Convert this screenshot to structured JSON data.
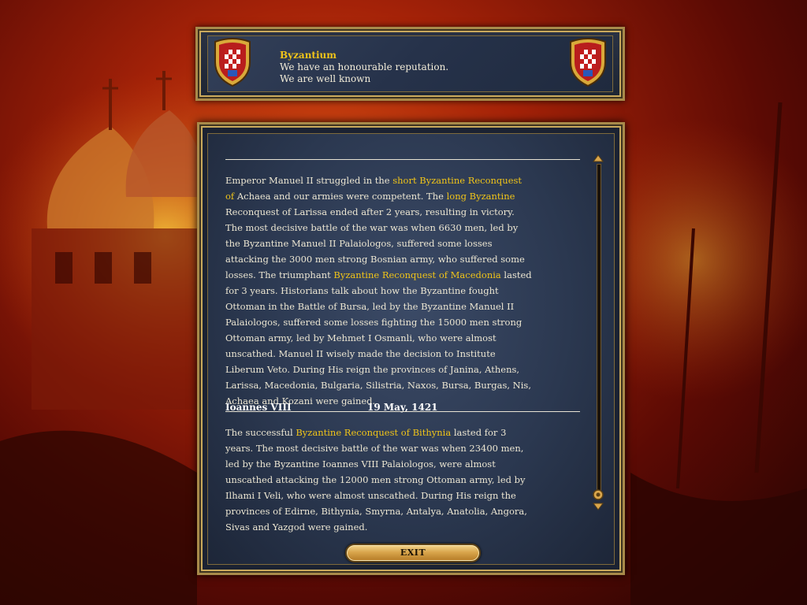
{
  "header": {
    "nation": "Byzantium",
    "line1": "We have an honourable reputation.",
    "line2": "We are well known"
  },
  "history": {
    "para1": [
      {
        "t": "Emperor Manuel II struggled in the "
      },
      {
        "t": "short Byzantine Reconquest of",
        "hl": true
      },
      {
        "t": " Achaea and our armies were competent. The "
      },
      {
        "t": "long Byzantine",
        "hl": true
      },
      {
        "t": " Reconquest of Larissa ended after 2 years, resulting in victory. The most decisive battle of the war was when 6630 men, led by the Byzantine Manuel II Palaiologos, suffered some losses attacking the 3000 men strong Bosnian army, who suffered some losses. The triumphant "
      },
      {
        "t": "Byzantine Reconquest of Macedonia",
        "hl": true
      },
      {
        "t": " lasted for 3 years. Historians talk about how the Byzantine fought Ottoman in the Battle of Bursa, led by the Byzantine Manuel II Palaiologos, suffered some losses fighting the 15000 men strong Ottoman army, led by Mehmet I Osmanli, who were almost unscathed. Manuel II wisely made the decision to Institute Liberum Veto. During His reign the provinces of Janina, Athens, Larissa, Macedonia, Bulgaria, Silistria, Naxos, Bursa, Burgas, Nis, Achaea and Kozani were gained."
      }
    ],
    "reign2": {
      "ruler": "Ioannes VIII",
      "date": "19 May, 1421"
    },
    "para2": [
      {
        "t": "The successful "
      },
      {
        "t": "Byzantine Reconquest of Bithynia",
        "hl": true
      },
      {
        "t": " lasted for 3 years. The most decisive battle of the war was when 23400 men, led by the Byzantine Ioannes VIII Palaiologos, were almost unscathed attacking the 12000 men strong Ottoman army, led by Ilhami I Veli, who were almost unscathed. During His reign the provinces of Edirne, Bithynia, Smyrna, Antalya, Anatolia, Angora, Sivas and Yazgod were gained."
      }
    ]
  },
  "buttons": {
    "exit": "EXIT"
  },
  "colors": {
    "highlight": "#f0c419",
    "text": "#ece6d2",
    "panel": "#2b3850",
    "frame": "#c9a95c"
  },
  "icons": {
    "shield": "byzantine-shield-icon",
    "scroll_up": "scroll-up-arrow-icon",
    "scroll_down": "scroll-down-arrow-icon"
  }
}
